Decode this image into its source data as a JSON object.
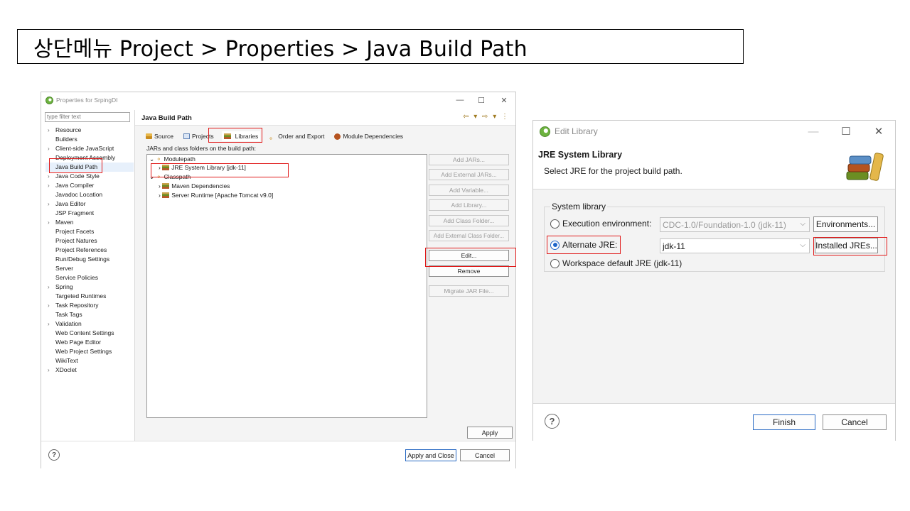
{
  "slide_title": "상단메뉴 Project > Properties > Java Build Path",
  "properties_dialog": {
    "window_title": "Properties for SrpingDI",
    "filter_placeholder": "type filter text",
    "tree": [
      {
        "label": "Resource",
        "expandable": true
      },
      {
        "label": "Builders",
        "expandable": false
      },
      {
        "label": "Client-side JavaScript",
        "expandable": true
      },
      {
        "label": "Deployment Assembly",
        "expandable": false
      },
      {
        "label": "Java Build Path",
        "expandable": false,
        "selected": true
      },
      {
        "label": "Java Code Style",
        "expandable": true
      },
      {
        "label": "Java Compiler",
        "expandable": true
      },
      {
        "label": "Javadoc Location",
        "expandable": false
      },
      {
        "label": "Java Editor",
        "expandable": true
      },
      {
        "label": "JSP Fragment",
        "expandable": false
      },
      {
        "label": "Maven",
        "expandable": true
      },
      {
        "label": "Project Facets",
        "expandable": false
      },
      {
        "label": "Project Natures",
        "expandable": false
      },
      {
        "label": "Project References",
        "expandable": false
      },
      {
        "label": "Run/Debug Settings",
        "expandable": false
      },
      {
        "label": "Server",
        "expandable": false
      },
      {
        "label": "Service Policies",
        "expandable": false
      },
      {
        "label": "Spring",
        "expandable": true
      },
      {
        "label": "Targeted Runtimes",
        "expandable": false
      },
      {
        "label": "Task Repository",
        "expandable": true
      },
      {
        "label": "Task Tags",
        "expandable": false
      },
      {
        "label": "Validation",
        "expandable": true
      },
      {
        "label": "Web Content Settings",
        "expandable": false
      },
      {
        "label": "Web Page Editor",
        "expandable": false
      },
      {
        "label": "Web Project Settings",
        "expandable": false
      },
      {
        "label": "WikiText",
        "expandable": false
      },
      {
        "label": "XDoclet",
        "expandable": true
      }
    ],
    "page_title": "Java Build Path",
    "tabs": [
      "Source",
      "Projects",
      "Libraries",
      "Order and Export",
      "Module Dependencies"
    ],
    "active_tab": "Libraries",
    "path_label": "JARs and class folders on the build path:",
    "lib_tree": {
      "modulepath": "Modulepath",
      "jre": "JRE System Library [jdk-11]",
      "classpath": "Classpath",
      "maven": "Maven Dependencies",
      "server": "Server Runtime [Apache Tomcat v9.0]"
    },
    "buttons": {
      "add_jars": "Add JARs...",
      "add_external_jars": "Add External JARs...",
      "add_variable": "Add Variable...",
      "add_library": "Add Library...",
      "add_class_folder": "Add Class Folder...",
      "add_external_class_folder": "Add External Class Folder...",
      "edit": "Edit...",
      "remove": "Remove",
      "migrate_jar": "Migrate JAR File...",
      "apply": "Apply",
      "apply_and_close": "Apply and Close",
      "cancel": "Cancel"
    }
  },
  "edit_library_dialog": {
    "window_title": "Edit Library",
    "header_title": "JRE System Library",
    "header_desc": "Select JRE for the project build path.",
    "group_label": "System library",
    "exec_env_label": "Execution environment:",
    "exec_env_value": "CDC-1.0/Foundation-1.0 (jdk-11)",
    "environments_button": "Environments...",
    "alternate_label": "Alternate JRE:",
    "alternate_value": "jdk-11",
    "installed_button": "Installed JREs...",
    "workspace_label": "Workspace default JRE (jdk-11)",
    "selected_option": "alternate",
    "finish_button": "Finish",
    "cancel_button": "Cancel"
  },
  "colors": {
    "highlight_box": "#e01a1a",
    "radio_selected": "#1e65c9"
  }
}
